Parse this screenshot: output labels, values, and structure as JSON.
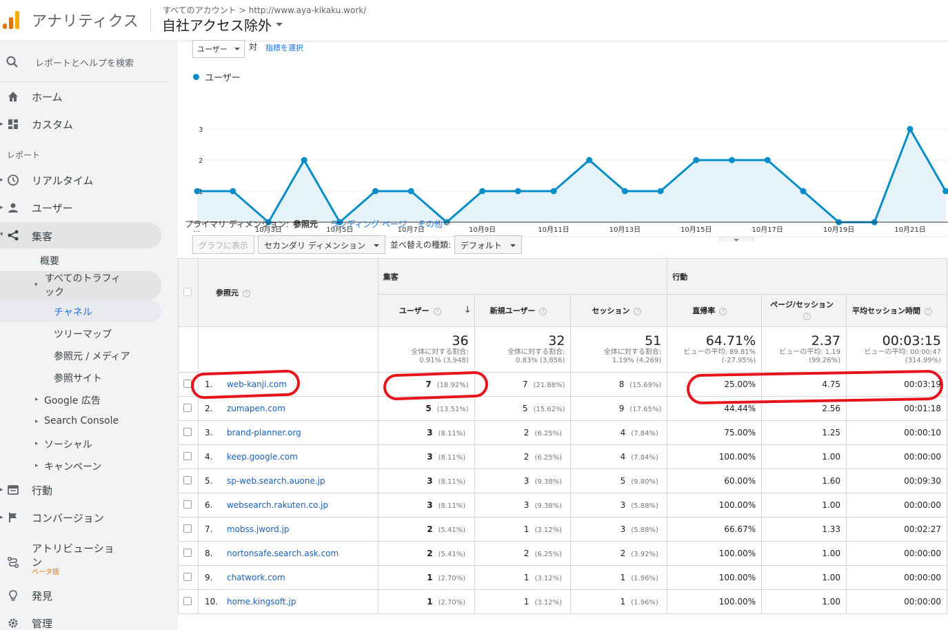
{
  "header": {
    "app_name": "アナリティクス",
    "breadcrumb_all": "すべてのアカウント",
    "breadcrumb_sep": ">",
    "breadcrumb_property": "http://www.aya-kikaku.work/",
    "view_name": "自社アクセス除外"
  },
  "sidebar": {
    "search_placeholder": "レポートとヘルプを検索",
    "home": "ホーム",
    "custom": "カスタム",
    "reports_label": "レポート",
    "realtime": "リアルタイム",
    "audience": "ユーザー",
    "acquisition": "集客",
    "overview": "概要",
    "all_traffic_l1": "すべてのトラフィ",
    "all_traffic_l2": "ック",
    "channels": "チャネル",
    "treemap": "ツリーマップ",
    "source_medium": "参照元 / メディア",
    "referrals": "参照サイト",
    "google_ads": "Google 広告",
    "search_console": "Search Console",
    "social": "ソーシャル",
    "campaigns": "キャンペーン",
    "behavior": "行動",
    "conversions": "コンバージョン",
    "attribution_l1": "アトリビューショ",
    "attribution_l2": "ン",
    "beta": "ベータ版",
    "discover": "発見",
    "admin": "管理"
  },
  "controls": {
    "metric_select": "ユーザー",
    "vs": "対",
    "select_metric": "指標を選択",
    "legend_label": "ユーザー"
  },
  "chart_data": {
    "type": "line",
    "series": [
      {
        "name": "ユーザー",
        "values": [
          1,
          1,
          0,
          2,
          0,
          1,
          1,
          0,
          1,
          1,
          1,
          2,
          1,
          1,
          2,
          2,
          2,
          1,
          0,
          0,
          3,
          1
        ]
      }
    ],
    "x_ticks": [
      "…",
      "10月3日",
      "10月5日",
      "10月7日",
      "10月9日",
      "10月11日",
      "10月13日",
      "10月15日",
      "10月17日",
      "10月19日",
      "10月21日"
    ],
    "y_ticks": [
      "1",
      "2",
      "3"
    ],
    "ylim": [
      0,
      3
    ],
    "color": "#058dc7",
    "fill": "#e6f2f9",
    "grid": true
  },
  "dimension": {
    "label": "プライマリ ディメンション:",
    "current": "参照元",
    "landing": "ランディング ページ",
    "other": "その他"
  },
  "toolbar": {
    "plot": "グラフに表示",
    "secondary": "セカンダリ ディメンション",
    "sort_label": "並べ替えの種類:",
    "sort_value": "デフォルト"
  },
  "table": {
    "source_header": "参照元",
    "group_acq": "集客",
    "group_beh": "行動",
    "columns": [
      "ユーザー",
      "新規ユーザー",
      "セッション",
      "直帰率",
      "ページ/セッション",
      "平均セッション時間"
    ],
    "sort_arrow": "↓",
    "help": "?",
    "totals": [
      {
        "big": "36",
        "l1": "全体に対する割合:",
        "l2": "0.91% (3,948)"
      },
      {
        "big": "32",
        "l1": "全体に対する割合:",
        "l2": "0.83% (3,856)"
      },
      {
        "big": "51",
        "l1": "全体に対する割合:",
        "l2": "1.19% (4,269)"
      },
      {
        "big": "64.71%",
        "l1": "ビューの平均: 89.81%",
        "l2": "(-27.95%)"
      },
      {
        "big": "2.37",
        "l1": "ビューの平均: 1.19",
        "l2": "(99.26%)"
      },
      {
        "big": "00:03:15",
        "l1": "ビューの平均: 00:00:47",
        "l2": "(314.99%)"
      }
    ],
    "rows": [
      {
        "idx": "1.",
        "src": "web-kanji.com",
        "users": "7",
        "users_pct": "(18.92%)",
        "new": "7",
        "new_pct": "(21.88%)",
        "sess": "8",
        "sess_pct": "(15.69%)",
        "bounce": "25.00%",
        "pps": "4.75",
        "dur": "00:03:19"
      },
      {
        "idx": "2.",
        "src": "zumapen.com",
        "users": "5",
        "users_pct": "(13.51%)",
        "new": "5",
        "new_pct": "(15.62%)",
        "sess": "9",
        "sess_pct": "(17.65%)",
        "bounce": "44.44%",
        "pps": "2.56",
        "dur": "00:01:18"
      },
      {
        "idx": "3.",
        "src": "brand-planner.org",
        "users": "3",
        "users_pct": "(8.11%)",
        "new": "2",
        "new_pct": "(6.25%)",
        "sess": "4",
        "sess_pct": "(7.84%)",
        "bounce": "75.00%",
        "pps": "1.25",
        "dur": "00:00:10"
      },
      {
        "idx": "4.",
        "src": "keep.google.com",
        "users": "3",
        "users_pct": "(8.11%)",
        "new": "2",
        "new_pct": "(6.25%)",
        "sess": "4",
        "sess_pct": "(7.84%)",
        "bounce": "100.00%",
        "pps": "1.00",
        "dur": "00:00:00"
      },
      {
        "idx": "5.",
        "src": "sp-web.search.auone.jp",
        "users": "3",
        "users_pct": "(8.11%)",
        "new": "3",
        "new_pct": "(9.38%)",
        "sess": "5",
        "sess_pct": "(9.80%)",
        "bounce": "60.00%",
        "pps": "1.60",
        "dur": "00:09:30"
      },
      {
        "idx": "6.",
        "src": "websearch.rakuten.co.jp",
        "users": "3",
        "users_pct": "(8.11%)",
        "new": "3",
        "new_pct": "(9.38%)",
        "sess": "3",
        "sess_pct": "(5.88%)",
        "bounce": "100.00%",
        "pps": "1.00",
        "dur": "00:00:00"
      },
      {
        "idx": "7.",
        "src": "mobss.jword.jp",
        "users": "2",
        "users_pct": "(5.41%)",
        "new": "1",
        "new_pct": "(3.12%)",
        "sess": "3",
        "sess_pct": "(5.88%)",
        "bounce": "66.67%",
        "pps": "1.33",
        "dur": "00:02:27"
      },
      {
        "idx": "8.",
        "src": "nortonsafe.search.ask.com",
        "users": "2",
        "users_pct": "(5.41%)",
        "new": "2",
        "new_pct": "(6.25%)",
        "sess": "2",
        "sess_pct": "(3.92%)",
        "bounce": "100.00%",
        "pps": "1.00",
        "dur": "00:00:00"
      },
      {
        "idx": "9.",
        "src": "chatwork.com",
        "users": "1",
        "users_pct": "(2.70%)",
        "new": "1",
        "new_pct": "(3.12%)",
        "sess": "1",
        "sess_pct": "(1.96%)",
        "bounce": "100.00%",
        "pps": "1.00",
        "dur": "00:00:00"
      },
      {
        "idx": "10.",
        "src": "home.kingsoft.jp",
        "users": "1",
        "users_pct": "(2.70%)",
        "new": "1",
        "new_pct": "(3.12%)",
        "sess": "1",
        "sess_pct": "(1.96%)",
        "bounce": "100.00%",
        "pps": "1.00",
        "dur": "00:00:00"
      }
    ]
  },
  "colors": {
    "line": "#058dc7",
    "annotation": "#e8141b",
    "link": "#1a5fb4"
  }
}
